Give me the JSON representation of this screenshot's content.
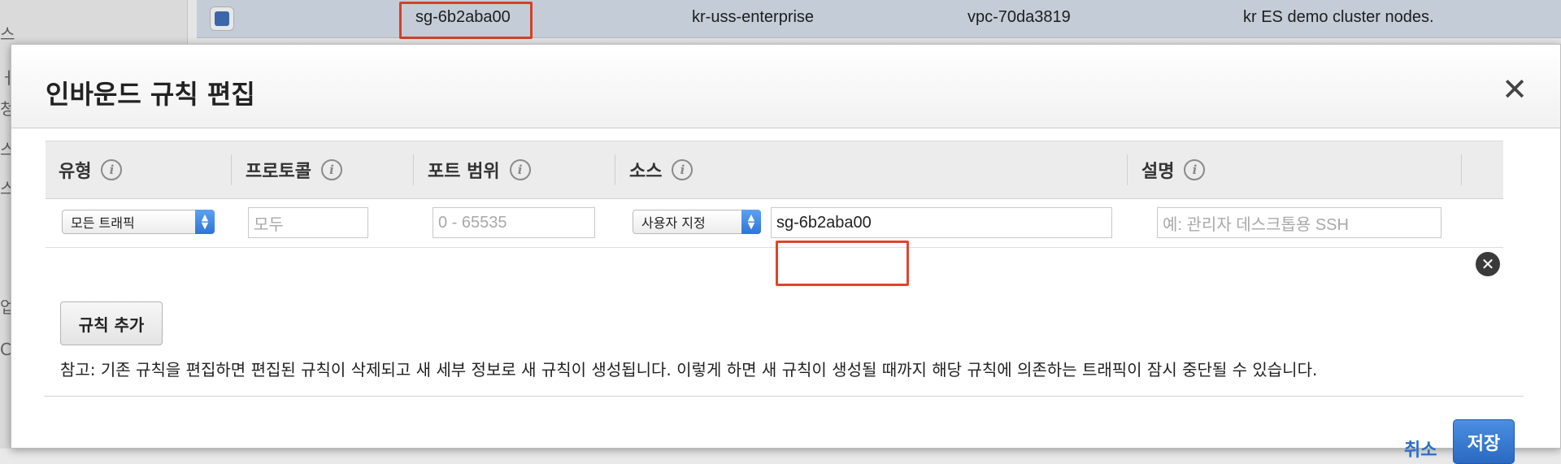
{
  "background": {
    "sidebar_chars": [
      "스",
      "ㅓ",
      "청",
      "스",
      "스",
      "업",
      "C"
    ],
    "selected_row": {
      "group_id": "sg-6b2aba00",
      "group_name": "kr-uss-enterprise",
      "vpc_id": "vpc-70da3819",
      "description": "kr ES demo cluster nodes."
    }
  },
  "modal": {
    "title": "인바운드 규칙 편집",
    "close_icon": "✕",
    "columns": {
      "type": "유형",
      "protocol": "프로토콜",
      "port_range": "포트 범위",
      "source": "소스",
      "description": "설명"
    },
    "info_icon_glyph": "i",
    "rule": {
      "type_value": "모든 트래픽",
      "protocol_placeholder": "모두",
      "port_placeholder": "0 - 65535",
      "source_type": "사용자 지정",
      "source_value": "sg-6b2aba00",
      "description_placeholder": "예: 관리자 데스크톱용 SSH",
      "remove_icon": "✕"
    },
    "add_rule_label": "규칙 추가",
    "note": "참고: 기존 규칙을 편집하면 편집된 규칙이 삭제되고 새 세부 정보로 새 규칙이 생성됩니다. 이렇게 하면 새 규칙이 생성될 때까지 해당 규칙에 의존하는 트래픽이 잠시 중단될 수 있습니다.",
    "cancel_label": "취소",
    "save_label": "저장"
  },
  "colors": {
    "highlight": "#e0442b",
    "primary_button": "#2a69c2",
    "link": "#2b6fc8",
    "select_arrow": "#3a82e4"
  },
  "icons": {
    "close": "close-icon",
    "info": "info-icon",
    "remove": "remove-rule-icon",
    "select": "chevron-updown-icon"
  }
}
